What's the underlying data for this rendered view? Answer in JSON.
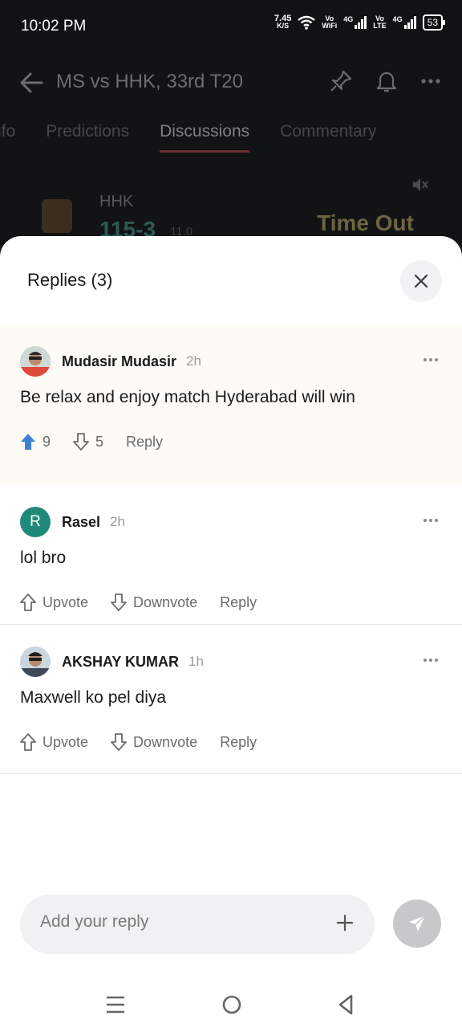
{
  "status_bar": {
    "time": "10:02 PM",
    "speed_value": "7.45",
    "speed_unit": "K/S",
    "vowifi_top": "Vo",
    "vowifi_bottom": "WiFi",
    "sim1_type": "4G",
    "volte_top": "Vo",
    "volte_bottom": "LTE",
    "sim2_type": "4G",
    "battery": "53"
  },
  "header": {
    "title": "MS vs HHK, 33rd T20",
    "icons": [
      "back-arrow-icon",
      "pin-icon",
      "bell-icon",
      "more-icon"
    ]
  },
  "tabs": [
    {
      "label": "nfo"
    },
    {
      "label": "Predictions"
    },
    {
      "label": "Discussions",
      "active": true
    },
    {
      "label": "Commentary"
    }
  ],
  "scoreboard": {
    "team": "HHK",
    "score": "115-3",
    "overs": "11.0",
    "status": "Time Out"
  },
  "sheet": {
    "title": "Replies (3)",
    "comments": [
      {
        "name": "Mudasir Mudasir",
        "time": "2h",
        "text": "Be relax and enjoy match Hyderabad will win",
        "upvotes": "9",
        "downvotes": "5",
        "reply_label": "Reply",
        "avatar": "photo"
      },
      {
        "name": "Rasel",
        "time": "2h",
        "text": "lol bro",
        "upvote_label": "Upvote",
        "downvote_label": "Downvote",
        "reply_label": "Reply",
        "avatar_letter": "R",
        "avatar_color": "#1f8a7a"
      },
      {
        "name": "AKSHAY KUMAR",
        "time": "1h",
        "text": "Maxwell ko pel diya",
        "upvote_label": "Upvote",
        "downvote_label": "Downvote",
        "reply_label": "Reply",
        "avatar": "photo"
      }
    ],
    "reply_placeholder": "Add your reply"
  },
  "colors": {
    "upvote_active": "#3f7fd9",
    "highlight_bg": "#fdfbf5",
    "send_button": "#c8c8ca"
  }
}
